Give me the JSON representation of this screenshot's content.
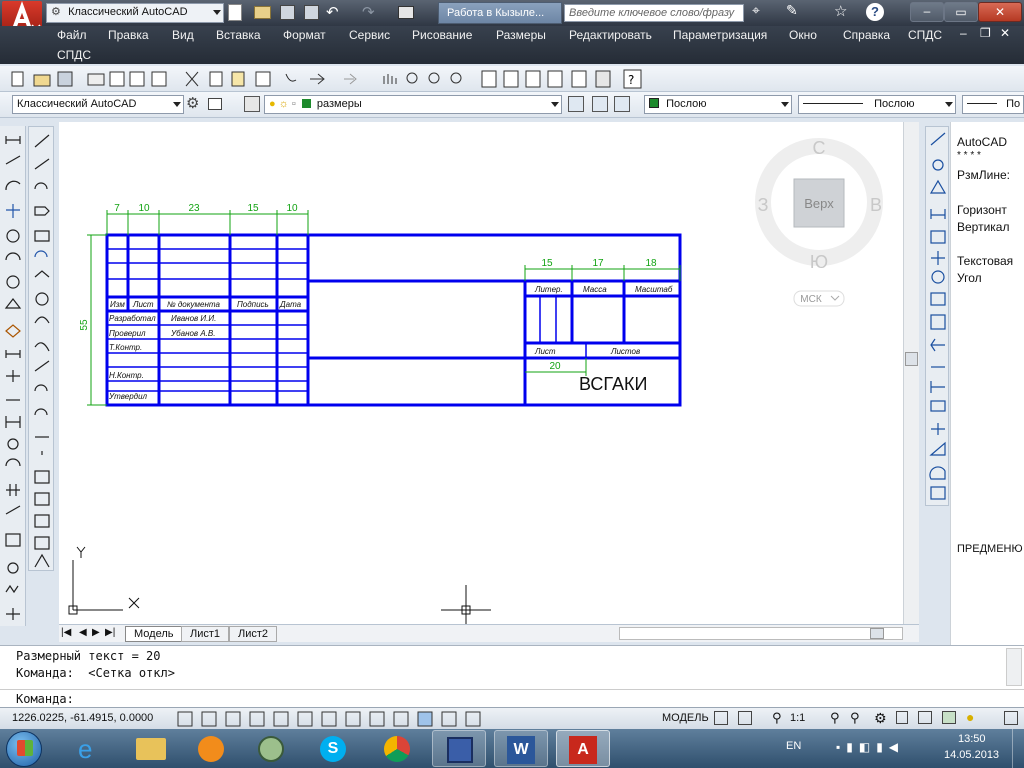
{
  "titlebar": {
    "workspace": "Классический AutoCAD",
    "tab_text": "Работа в Кызыле...",
    "search_placeholder": "Введите ключевое слово/фразу"
  },
  "menu": [
    "Файл",
    "Правка",
    "Вид",
    "Вставка",
    "Формат",
    "Сервис",
    "Рисование",
    "Размеры",
    "Редактировать",
    "Параметризация",
    "Окно",
    "Справка",
    "СПДС"
  ],
  "menu_second_row": "СПДС",
  "props_bar": {
    "workspace": "Классический AutoCAD",
    "layer": "размеры",
    "color": "Послою",
    "linetype": "Послою",
    "lineweight": "По"
  },
  "viewcube": {
    "top": "Верх",
    "north": "С",
    "south": "Ю",
    "east": "В",
    "west": "З",
    "ucs": "МСК"
  },
  "drawing": {
    "dim_7": "7",
    "dim_10a": "10",
    "dim_23": "23",
    "dim_15": "15",
    "dim_10b": "10",
    "dim_55": "55",
    "dim_15b": "15",
    "dim_17": "17",
    "dim_18": "18",
    "dim_20": "20",
    "hdr_izm": "Изм",
    "hdr_list": "Лист",
    "hdr_ndoc": "№ документа",
    "hdr_podpis": "Подпись",
    "hdr_data": "Дата",
    "row_razrab": "Разработал",
    "row_razrab_name": "Иванов И.И.",
    "row_prover": "Проверил",
    "row_prover_name": "Убанов А.В.",
    "row_tkontr": "Т.Контр.",
    "row_nkontr": "Н.Контр.",
    "row_utverd": "Утвердил",
    "liter": "Литер.",
    "massa": "Масса",
    "masshtab": "Масштаб",
    "list": "Лист",
    "listov": "Листов",
    "org": "ВСГАКИ"
  },
  "layout_tabs": [
    "Модель",
    "Лист1",
    "Лист2"
  ],
  "properties_panel": {
    "line1": "AutoCAD",
    "line2": "* * * *",
    "line3": "РзмЛине:",
    "line4": "Горизонт",
    "line5": "Вертикал",
    "line6": "Текстовая",
    "line7": "Угол",
    "line8": "ПРЕДМЕНЮ"
  },
  "command": {
    "line1": "Размерный текст = 20",
    "line2": "Команда:  <Сетка откл>",
    "prompt": "Команда:"
  },
  "status": {
    "coords": "1226.0225, -61.4915, 0.0000",
    "model": "МОДЕЛЬ",
    "scale": "1:1"
  },
  "taskbar": {
    "lang": "EN",
    "time": "13:50",
    "date": "14.05.2013"
  }
}
